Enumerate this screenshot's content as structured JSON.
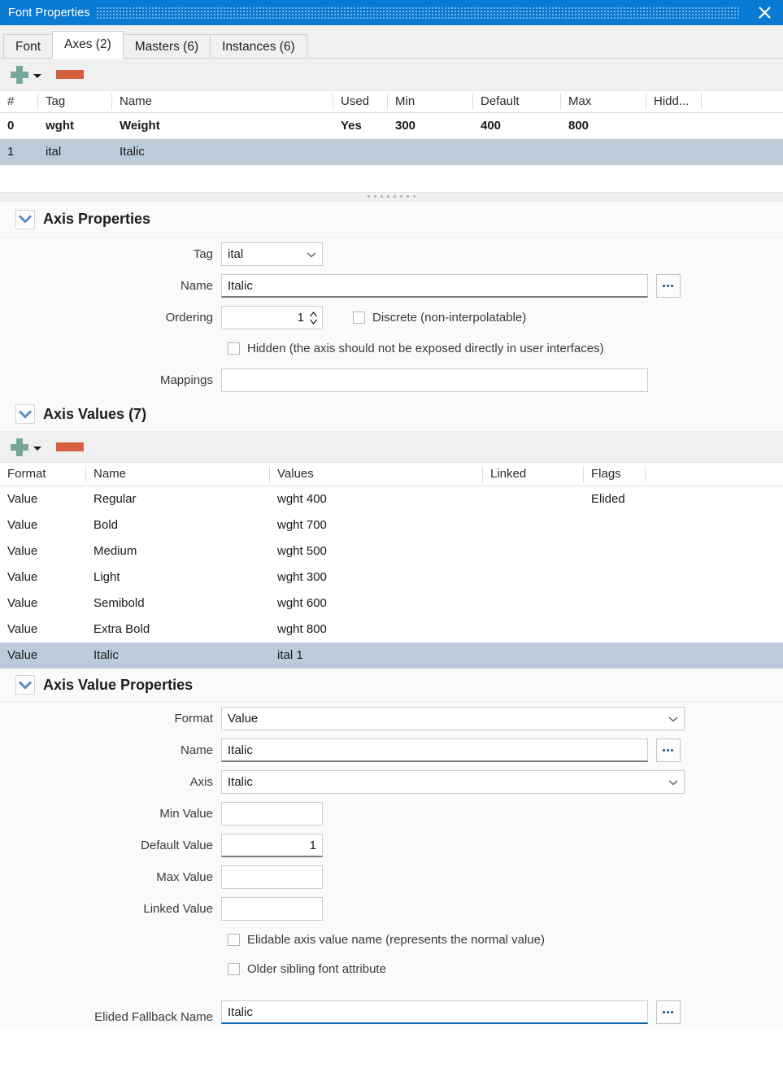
{
  "window": {
    "title": "Font Properties",
    "close_icon": "close-icon"
  },
  "tabs": [
    {
      "label": "Font",
      "active": false
    },
    {
      "label": "Axes (2)",
      "active": true
    },
    {
      "label": "Masters (6)",
      "active": false
    },
    {
      "label": "Instances (6)",
      "active": false
    }
  ],
  "axes_toolbar": {
    "add_icon": "plus-icon",
    "add_dropdown_icon": "chevron-down-icon",
    "remove_icon": "minus-icon"
  },
  "axes_table": {
    "columns": [
      "#",
      "Tag",
      "Name",
      "Used",
      "Min",
      "Default",
      "Max",
      "Hidd..."
    ],
    "rows": [
      {
        "num": "0",
        "tag": "wght",
        "name": "Weight",
        "used": "Yes",
        "min": "300",
        "default": "400",
        "max": "800",
        "hidden": "",
        "selected": false,
        "bold": true
      },
      {
        "num": "1",
        "tag": "ital",
        "name": "Italic",
        "used": "",
        "min": "",
        "default": "",
        "max": "",
        "hidden": "",
        "selected": true,
        "bold": false
      }
    ]
  },
  "axis_properties": {
    "section_title": "Axis Properties",
    "collapse_icon": "chevron-down-icon",
    "tag": {
      "label": "Tag",
      "value": "ital"
    },
    "name": {
      "label": "Name",
      "value": "Italic",
      "browse_label": "..."
    },
    "ordering": {
      "label": "Ordering",
      "value": "1"
    },
    "discrete": {
      "label": "Discrete (non-interpolatable)",
      "checked": false
    },
    "hidden": {
      "label": "Hidden (the axis should not be exposed directly in user interfaces)",
      "checked": false
    },
    "mappings": {
      "label": "Mappings",
      "value": ""
    }
  },
  "axis_values": {
    "section_title": "Axis Values (7)",
    "collapse_icon": "chevron-down-icon",
    "toolbar": {
      "add_icon": "plus-icon",
      "add_dropdown_icon": "chevron-down-icon",
      "remove_icon": "minus-icon"
    },
    "columns": [
      "Format",
      "Name",
      "Values",
      "Linked",
      "Flags"
    ],
    "rows": [
      {
        "format": "Value",
        "name": "Regular",
        "values": "wght 400",
        "linked": "",
        "flags": "Elided",
        "selected": false
      },
      {
        "format": "Value",
        "name": "Bold",
        "values": "wght 700",
        "linked": "",
        "flags": "",
        "selected": false
      },
      {
        "format": "Value",
        "name": "Medium",
        "values": "wght 500",
        "linked": "",
        "flags": "",
        "selected": false
      },
      {
        "format": "Value",
        "name": "Light",
        "values": "wght 300",
        "linked": "",
        "flags": "",
        "selected": false
      },
      {
        "format": "Value",
        "name": "Semibold",
        "values": "wght 600",
        "linked": "",
        "flags": "",
        "selected": false
      },
      {
        "format": "Value",
        "name": "Extra Bold",
        "values": "wght 800",
        "linked": "",
        "flags": "",
        "selected": false
      },
      {
        "format": "Value",
        "name": "Italic",
        "values": "ital 1",
        "linked": "",
        "flags": "",
        "selected": true
      }
    ]
  },
  "axis_value_properties": {
    "section_title": "Axis Value Properties",
    "collapse_icon": "chevron-down-icon",
    "format": {
      "label": "Format",
      "value": "Value"
    },
    "name": {
      "label": "Name",
      "value": "Italic",
      "browse_label": "..."
    },
    "axis": {
      "label": "Axis",
      "value": "Italic"
    },
    "min_value": {
      "label": "Min Value",
      "value": ""
    },
    "default_value": {
      "label": "Default Value",
      "value": "1"
    },
    "max_value": {
      "label": "Max Value",
      "value": ""
    },
    "linked_value": {
      "label": "Linked Value",
      "value": ""
    },
    "elidable": {
      "label": "Elidable axis value name (represents the normal value)",
      "checked": false
    },
    "older_sibling": {
      "label": "Older sibling font attribute",
      "checked": false
    },
    "elided_fallback_name": {
      "label": "Elided Fallback Name",
      "value": "Italic",
      "browse_label": "..."
    }
  },
  "colors": {
    "titlebar": "#0b7ad3",
    "selection": "#bccbda",
    "add_green": "#75a79a",
    "remove_red": "#d4603f",
    "focus_blue": "#1666b0",
    "chevron_blue": "#5a8ec4"
  }
}
